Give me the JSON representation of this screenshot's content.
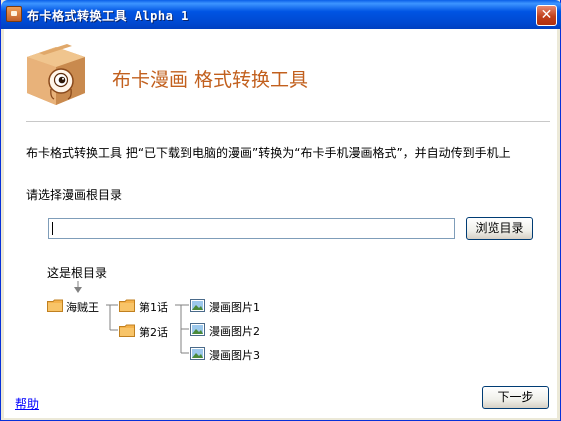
{
  "window": {
    "title": "布卡格式转换工具 Alpha 1",
    "close_glyph": "✕"
  },
  "header": {
    "logo_icon": "cardboard-box-mascot-icon",
    "title": "布卡漫画 格式转换工具"
  },
  "description": "布卡格式转换工具 把“已下载到电脑的漫画”转换为“布卡手机漫画格式”，并自动传到手机上",
  "directory": {
    "prompt": "请选择漫画根目录",
    "path_value": "",
    "browse_label": "浏览目录"
  },
  "example_tree": {
    "root_label": "这是根目录",
    "root_folder": "海贼王",
    "chapters": [
      "第1话",
      "第2话"
    ],
    "images": [
      "漫画图片1",
      "漫画图片2",
      "漫画图片3"
    ]
  },
  "footer": {
    "help_label": "帮助",
    "next_label": "下一步"
  },
  "colors": {
    "title_bar": "#0054e3",
    "accent_orange": "#c2601e",
    "folder": "#f5b24b",
    "link": "#0000ff"
  }
}
